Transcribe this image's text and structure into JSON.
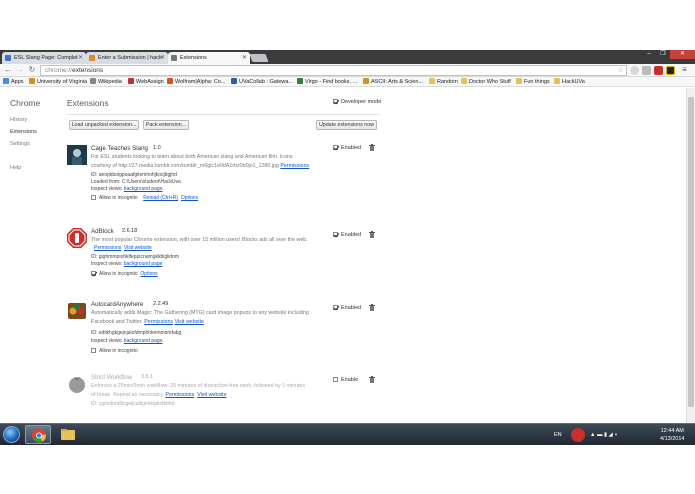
{
  "tabs": [
    {
      "title": "ESL Slang Page: Complet",
      "color": "#3b73c9"
    },
    {
      "title": "Enter a Submission | hack",
      "color": "#e08a2a"
    },
    {
      "title": "Extensions",
      "color": "#777777"
    }
  ],
  "toolbar": {
    "url_scheme": "chrome://",
    "url_path": "extensions",
    "back_icon": "arrow-left-icon",
    "forward_icon": "arrow-right-icon",
    "reload_icon": "reload-icon"
  },
  "bookmarks": [
    {
      "label": "Apps",
      "color": "#4a87e0"
    },
    {
      "label": "University of Virginia",
      "color": "#e38a1a"
    },
    {
      "label": "Wikipedia",
      "color": "#888888"
    },
    {
      "label": "WebAssign",
      "color": "#c03030"
    },
    {
      "label": "Wolfram|Alpha: Co...",
      "color": "#d8551c"
    },
    {
      "label": "UVaCollab : Gatewa...",
      "color": "#2f5fa0"
    },
    {
      "label": "Virgo - Find books, ...",
      "color": "#3c7c3c"
    },
    {
      "label": "ASCII: Arts & Scien...",
      "color": "#c99a2a"
    },
    {
      "label": "Random",
      "color": "#e6c25a"
    },
    {
      "label": "Doctor Who Stuff",
      "color": "#e6c25a"
    },
    {
      "label": "Fun things",
      "color": "#e6c25a"
    },
    {
      "label": "HackUVa",
      "color": "#e6c25a"
    }
  ],
  "sidebar": {
    "title": "Chrome",
    "items": [
      "History",
      "Extensions",
      "Settings",
      "Help"
    ]
  },
  "main": {
    "title": "Extensions",
    "developer_mode_label": "Developer mode",
    "load_unpacked": "Load unpacked extension...",
    "pack_extension": "Pack extension...",
    "update_extensions": "Update extensions now"
  },
  "extensions": [
    {
      "name": "Cage Teaches Slang",
      "version": "1.0",
      "desc1": "For ESL students looking to learn about both American slang and American film. Icons",
      "desc2": "courtesy of http://27.media.tumblr.com/tumblr_m6gic1e0dA1rbz0b0jo1_1280.jpg",
      "permissions": "Permissions",
      "id": "ID: aeopkbolgpoaafgilemhohjkocjbgjhd",
      "loaded": "Loaded from: C:\\Users\\student\\HackUva",
      "inspect": "Inspect views:",
      "inspect_link": "background page",
      "incognito": "Allow in incognito",
      "incognito_on": false,
      "reload": "Reload (Ctrl+R)",
      "options": "Options",
      "enabled_label": "Enabled",
      "enabled": true
    },
    {
      "name": "AdBlock",
      "version": "2.6.18",
      "desc1": "The most popular Chrome extension, with over 15 million users! Blocks ads all over the web.",
      "permissions": "Permissions",
      "visit": "Visit website",
      "id": "ID: gighmmpiobklfepjocnamgkkbiglidom",
      "inspect": "Inspect views:",
      "inspect_link": "background page",
      "incognito": "Allow in incognito",
      "incognito_on": true,
      "options": "Options",
      "enabled_label": "Enabled",
      "enabled": true
    },
    {
      "name": "AutocardAnywhere",
      "version": "2.2.49",
      "desc1": "Automatically adds Magic: The Gathering (MTG) card image popups to any website including",
      "desc2_prefix": "Facebook and Twitter.",
      "permissions": "Permissions",
      "visit": "Visit website",
      "id": "ID: ediikhgkgejnjaiofdmphhkemmomfabg",
      "inspect": "Inspect views:",
      "inspect_link": "background page",
      "incognito": "Allow in incognito",
      "incognito_on": false,
      "enabled_label": "Enabled",
      "enabled": true
    },
    {
      "name": "Strict Workflow",
      "version": "3.6.1",
      "desc1": "Enforces a 25min/5min workflow: 25 minutes of distraction-free work, followed by 5 minutes",
      "desc2_prefix": "of break. Repeat as necessary.",
      "permissions": "Permissions",
      "visit": "Visit website",
      "id": "ID: cgmnfnmlficgeijcalkgnnkigkefkbhd",
      "enabled_label": "Enable",
      "enabled": false
    }
  ],
  "taskbar": {
    "lang": "EN",
    "time": "12:44 AM",
    "date": "4/13/2014"
  }
}
